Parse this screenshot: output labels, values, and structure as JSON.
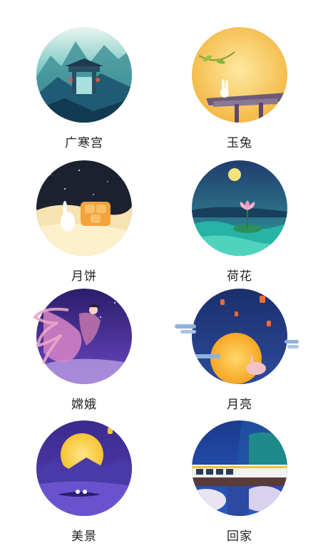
{
  "items": [
    {
      "label": "广寒宫",
      "icon": "moon-palace-illustration"
    },
    {
      "label": "玉兔",
      "icon": "jade-rabbit-illustration"
    },
    {
      "label": "月饼",
      "icon": "mooncake-illustration"
    },
    {
      "label": "荷花",
      "icon": "lotus-illustration"
    },
    {
      "label": "嫦娥",
      "icon": "change-goddess-illustration"
    },
    {
      "label": "月亮",
      "icon": "moon-illustration"
    },
    {
      "label": "美景",
      "icon": "scenery-illustration"
    },
    {
      "label": "回家",
      "icon": "going-home-train-illustration"
    }
  ],
  "colors": {
    "label": "#222222",
    "background": "#ffffff"
  }
}
